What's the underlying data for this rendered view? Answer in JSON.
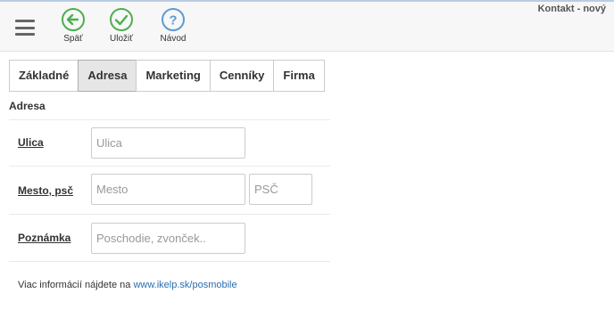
{
  "header": {
    "window_title": "Kontakt - nový",
    "back_label": "Späť",
    "save_label": "Uložiť",
    "help_label": "Návod",
    "colors": {
      "back": "#4caf50",
      "save": "#4caf50",
      "help": "#5b9bd5"
    }
  },
  "tabs": [
    {
      "label": "Základné",
      "active": false
    },
    {
      "label": "Adresa",
      "active": true
    },
    {
      "label": "Marketing",
      "active": false
    },
    {
      "label": "Cenníky",
      "active": false
    },
    {
      "label": "Firma",
      "active": false
    }
  ],
  "section": {
    "title": "Adresa"
  },
  "form": {
    "street": {
      "label": "Ulica",
      "placeholder": "Ulica",
      "value": ""
    },
    "city": {
      "label": "Mesto, psč",
      "placeholder": "Mesto",
      "value": ""
    },
    "zip": {
      "placeholder": "PSČ",
      "value": ""
    },
    "note": {
      "label": "Poznámka",
      "placeholder": "Poschodie, zvonček..",
      "value": ""
    }
  },
  "footer": {
    "info_text": "Viac informácií nájdete na",
    "link_text": "www.ikelp.sk/posmobile"
  }
}
